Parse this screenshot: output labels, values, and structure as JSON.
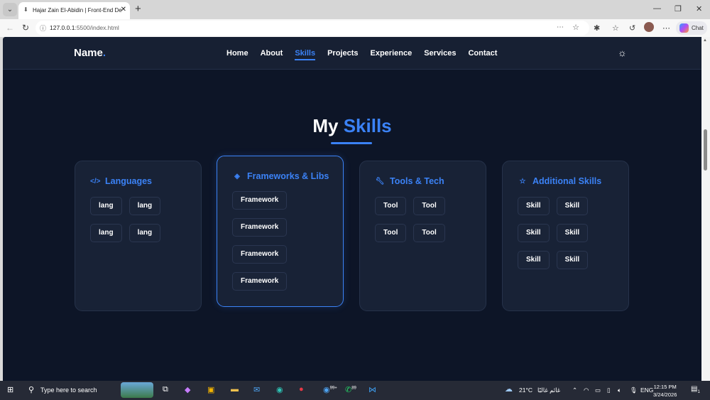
{
  "browser": {
    "tab_title": "Hajar Zain El-Abidin | Front-End De",
    "url_host": "127.0.0.1",
    "url_path": ":5500/index.html",
    "chat_label": "Chat"
  },
  "nav": {
    "brand": "Name",
    "brand_dot": ".",
    "links": [
      "Home",
      "About",
      "Skills",
      "Projects",
      "Experience",
      "Services",
      "Contact"
    ],
    "active": "Skills"
  },
  "section": {
    "title_a": "My",
    "title_b": "Skills"
  },
  "cards": [
    {
      "title": "Languages",
      "icon": "code-icon",
      "items": [
        "lang",
        "lang",
        "lang",
        "lang"
      ]
    },
    {
      "title": "Frameworks & Libs",
      "icon": "layers-icon",
      "items": [
        "Framework",
        "Framework",
        "Framework",
        "Framework"
      ]
    },
    {
      "title": "Tools & Tech",
      "icon": "wrench-icon",
      "items": [
        "Tool",
        "Tool",
        "Tool",
        "Tool"
      ]
    },
    {
      "title": "Additional Skills",
      "icon": "star-icon",
      "items": [
        "Skill",
        "Skill",
        "Skill",
        "Skill",
        "Skill",
        "Skill"
      ]
    }
  ],
  "taskbar": {
    "search_placeholder": "Type here to search",
    "edge_badge": "99+",
    "whatsapp_badge": "89",
    "weather": "21°C",
    "weather_text": "غائم غالبًا",
    "lang": "ENG",
    "time": "12:15 PM",
    "date": "3/24/2026",
    "notif_count": "1"
  },
  "colors": {
    "accent": "#3b82f6",
    "bg": "#0d1527",
    "card": "#182236"
  }
}
